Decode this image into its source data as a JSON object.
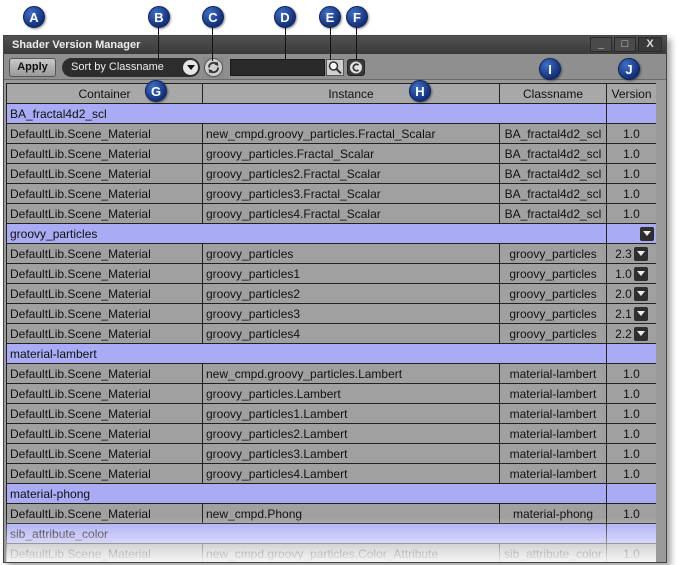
{
  "callouts": [
    "A",
    "B",
    "C",
    "D",
    "E",
    "F",
    "G",
    "H",
    "I",
    "J"
  ],
  "window": {
    "title": "Shader Version Manager",
    "minimize_glyph": "_",
    "maximize_glyph": "□",
    "close_glyph": "X"
  },
  "toolbar": {
    "apply_label": "Apply",
    "sort_value": "Sort by Classname",
    "search_value": ""
  },
  "icons": {
    "refresh": "refresh-icon",
    "search": "magnifier-icon",
    "clear": "clear-icon",
    "dropdown": "dropdown-arrow-icon"
  },
  "colors": {
    "group_row": "#a9abf4",
    "item_row": "#a0a0a0",
    "callout": "#1e3f94"
  },
  "table": {
    "columns": [
      "Container",
      "Instance",
      "Classname",
      "Version"
    ],
    "groups": [
      {
        "name": "BA_fractal4d2_scl",
        "has_dropdown": false,
        "rows": [
          {
            "container": "DefaultLib.Scene_Material",
            "instance": "new_cmpd.groovy_particles.Fractal_Scalar",
            "classname": "BA_fractal4d2_scl",
            "version": "1.0",
            "dropdown": false
          },
          {
            "container": "DefaultLib.Scene_Material",
            "instance": "groovy_particles.Fractal_Scalar",
            "classname": "BA_fractal4d2_scl",
            "version": "1.0",
            "dropdown": false
          },
          {
            "container": "DefaultLib.Scene_Material",
            "instance": "groovy_particles2.Fractal_Scalar",
            "classname": "BA_fractal4d2_scl",
            "version": "1.0",
            "dropdown": false
          },
          {
            "container": "DefaultLib.Scene_Material",
            "instance": "groovy_particles3.Fractal_Scalar",
            "classname": "BA_fractal4d2_scl",
            "version": "1.0",
            "dropdown": false
          },
          {
            "container": "DefaultLib.Scene_Material",
            "instance": "groovy_particles4.Fractal_Scalar",
            "classname": "BA_fractal4d2_scl",
            "version": "1.0",
            "dropdown": false
          }
        ]
      },
      {
        "name": "groovy_particles",
        "has_dropdown": true,
        "rows": [
          {
            "container": "DefaultLib.Scene_Material",
            "instance": "groovy_particles",
            "classname": "groovy_particles",
            "version": "2.3",
            "dropdown": true
          },
          {
            "container": "DefaultLib.Scene_Material",
            "instance": "groovy_particles1",
            "classname": "groovy_particles",
            "version": "1.0",
            "dropdown": true
          },
          {
            "container": "DefaultLib.Scene_Material",
            "instance": "groovy_particles2",
            "classname": "groovy_particles",
            "version": "2.0",
            "dropdown": true
          },
          {
            "container": "DefaultLib.Scene_Material",
            "instance": "groovy_particles3",
            "classname": "groovy_particles",
            "version": "2.1",
            "dropdown": true
          },
          {
            "container": "DefaultLib.Scene_Material",
            "instance": "groovy_particles4",
            "classname": "groovy_particles",
            "version": "2.2",
            "dropdown": true
          }
        ]
      },
      {
        "name": "material-lambert",
        "has_dropdown": false,
        "rows": [
          {
            "container": "DefaultLib.Scene_Material",
            "instance": "new_cmpd.groovy_particles.Lambert",
            "classname": "material-lambert",
            "version": "1.0",
            "dropdown": false
          },
          {
            "container": "DefaultLib.Scene_Material",
            "instance": "groovy_particles.Lambert",
            "classname": "material-lambert",
            "version": "1.0",
            "dropdown": false
          },
          {
            "container": "DefaultLib.Scene_Material",
            "instance": "groovy_particles1.Lambert",
            "classname": "material-lambert",
            "version": "1.0",
            "dropdown": false
          },
          {
            "container": "DefaultLib.Scene_Material",
            "instance": "groovy_particles2.Lambert",
            "classname": "material-lambert",
            "version": "1.0",
            "dropdown": false
          },
          {
            "container": "DefaultLib.Scene_Material",
            "instance": "groovy_particles3.Lambert",
            "classname": "material-lambert",
            "version": "1.0",
            "dropdown": false
          },
          {
            "container": "DefaultLib.Scene_Material",
            "instance": "groovy_particles4.Lambert",
            "classname": "material-lambert",
            "version": "1.0",
            "dropdown": false
          }
        ]
      },
      {
        "name": "material-phong",
        "has_dropdown": false,
        "rows": [
          {
            "container": "DefaultLib.Scene_Material",
            "instance": "new_cmpd.Phong",
            "classname": "material-phong",
            "version": "1.0",
            "dropdown": false
          }
        ]
      },
      {
        "name": "sib_attribute_color",
        "has_dropdown": false,
        "rows": [
          {
            "container": "DefaultLib.Scene_Material",
            "instance": "new_cmpd.groovy_particles.Color_Attribute",
            "classname": "sib_attribute_color",
            "version": "1.0",
            "dropdown": false
          }
        ]
      }
    ]
  }
}
